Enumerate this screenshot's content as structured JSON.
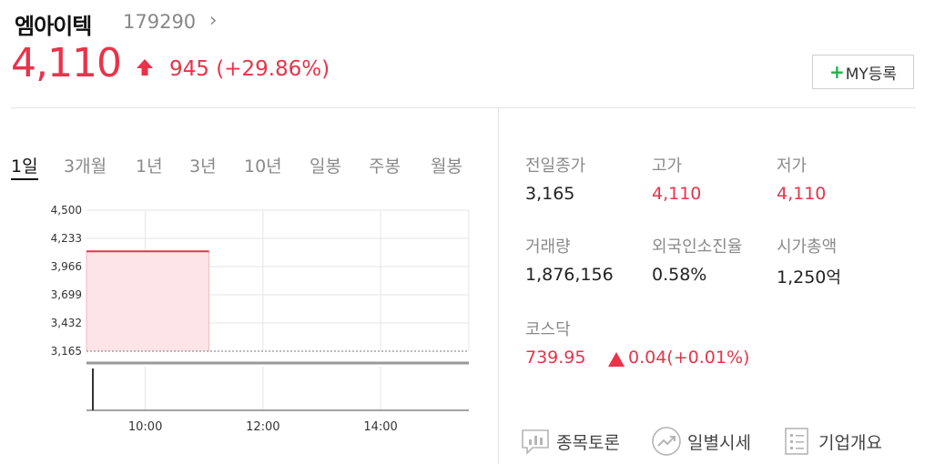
{
  "header": {
    "stock_name": "엠아이텍",
    "stock_code": "179290",
    "price": "4,110",
    "change": "945 (+29.86%)",
    "my_button_plus": "+",
    "my_button_label": "MY등록"
  },
  "tabs": [
    {
      "label": "1일",
      "active": true
    },
    {
      "label": "3개월",
      "active": false
    },
    {
      "label": "1년",
      "active": false
    },
    {
      "label": "3년",
      "active": false
    },
    {
      "label": "10년",
      "active": false
    },
    {
      "label": "일봉",
      "active": false
    },
    {
      "label": "주봉",
      "active": false
    },
    {
      "label": "월봉",
      "active": false
    }
  ],
  "stats": [
    {
      "label": "전일종가",
      "value": "3,165",
      "unit": "",
      "color": "#222222"
    },
    {
      "label": "고가",
      "value": "4,110",
      "unit": "",
      "color": "#e8334a"
    },
    {
      "label": "저가",
      "value": "4,110",
      "unit": "",
      "color": "#e8334a"
    },
    {
      "label": "거래량",
      "value": "1,876,156",
      "unit": "",
      "color": "#222222"
    },
    {
      "label": "외국인소진율",
      "value": "0.58%",
      "unit": "",
      "color": "#222222"
    },
    {
      "label": "시가총액",
      "value": "1,250",
      "unit": "억",
      "color": "#222222"
    }
  ],
  "index": {
    "label": "코스닥",
    "value": "739.95",
    "change": "0.04(+0.01%)"
  },
  "links": [
    {
      "label": "종목토론",
      "icon": "chat-bar-icon"
    },
    {
      "label": "일별시세",
      "icon": "trend-circle-icon"
    },
    {
      "label": "기업개요",
      "icon": "list-doc-icon"
    }
  ],
  "colors": {
    "up": "#e8334a",
    "fill": "#fde4e8",
    "accent_green": "#1fb14a"
  },
  "chart_data": {
    "type": "area",
    "y_ticks": [
      "4,500",
      "4,233",
      "3,966",
      "3,699",
      "3,432",
      "3,165"
    ],
    "x_ticks": [
      "10:00",
      "12:00",
      "14:00"
    ],
    "ylim": [
      3165,
      4500
    ],
    "x_range": [
      "09:00",
      "15:30"
    ],
    "reference_line": 3165,
    "series": [
      {
        "x": [
          "09:00",
          "11:05"
        ],
        "y": [
          4110,
          4110
        ]
      }
    ],
    "volume_bar": {
      "x": "09:00"
    }
  }
}
